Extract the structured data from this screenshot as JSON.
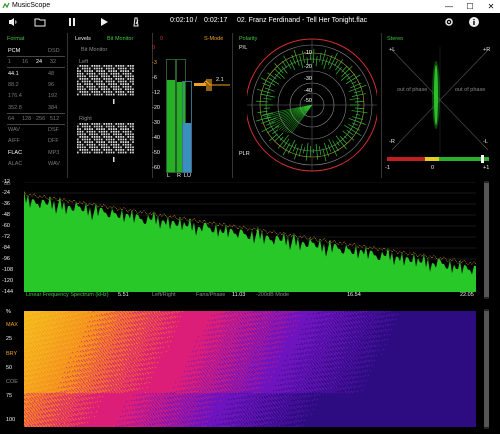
{
  "window": {
    "title": "MusicScope",
    "minimize": "—",
    "maximize": "☐",
    "close": "✕"
  },
  "toolbar": {
    "elapsed": "0:02:10",
    "divider": "/",
    "total": "0:02:17",
    "track": "02. Franz Ferdinand - Tell Her Tonight.flac"
  },
  "format": {
    "title": "Format",
    "rows": [
      [
        "PCM",
        "DSD"
      ],
      [
        "1",
        "16",
        "24",
        "32"
      ],
      [
        "44.1",
        "48"
      ],
      [
        "88.2",
        "96"
      ],
      [
        "176.4",
        "192"
      ],
      [
        "352.8",
        "384"
      ],
      [
        "64",
        "128",
        "256",
        "512"
      ],
      [
        "WAV",
        "DSF"
      ],
      [
        "AIFF",
        "DFF"
      ],
      [
        "FLAC",
        "MP3"
      ],
      [
        "ALAC",
        "WAV"
      ]
    ]
  },
  "levels": {
    "title": "Levels",
    "mode": "Bit Monitor",
    "sub": "Bit Monitor",
    "left": "Left",
    "right": "Right"
  },
  "meter": {
    "peak_label": "S-Mode",
    "top_value": "0",
    "side_value": "2.1",
    "scale": [
      "0",
      "-3",
      "-6",
      "-12",
      "-20",
      "-30",
      "-40",
      "-50",
      "-60"
    ],
    "channel_labels": [
      "L",
      "R",
      "LU"
    ],
    "left_level": 0.82,
    "right_level": 0.8,
    "lufs_level": 0.55
  },
  "polarity": {
    "title": "Polarity",
    "pl_label": "P/L",
    "plr_label": "PLR",
    "rings": [
      "-10",
      "-20",
      "-30",
      "-40",
      "-50"
    ]
  },
  "stereo": {
    "title": "Stereo",
    "plus_l": "+L",
    "plus_r": "+R",
    "minus_l": "-R",
    "minus_r": "-L",
    "out_of_phase_left": "out of phase",
    "out_of_phase_right": "out of phase",
    "scale_left": "-1",
    "scale_mid": "0",
    "scale_right": "+1"
  },
  "spectrum": {
    "ylabel": "dB",
    "ticks": [
      "-12",
      "-24",
      "-36",
      "-48",
      "-60",
      "-72",
      "-84",
      "-96",
      "-108",
      "-120",
      "-144"
    ],
    "mode_label": "Linear Frequency Spectrum (kHz)",
    "channel_mode": "Left/Right",
    "fp_mode": "Fans/Phase",
    "level_mode": "-200dB Mode",
    "xticks": [
      "5.51",
      "11.03",
      "16.54",
      "22.05"
    ],
    "colors": {
      "fill": "#28c828",
      "peak": "#e0a030"
    }
  },
  "spectrogram": {
    "ticks": [
      "%",
      "MAX",
      "25",
      "BRY",
      "50",
      "COE",
      "75",
      "100"
    ],
    "colors": {
      "hot": "#f5a01a",
      "mid": "#e0207a",
      "cool": "#5a18c0",
      "cold": "#2a0a80"
    }
  }
}
